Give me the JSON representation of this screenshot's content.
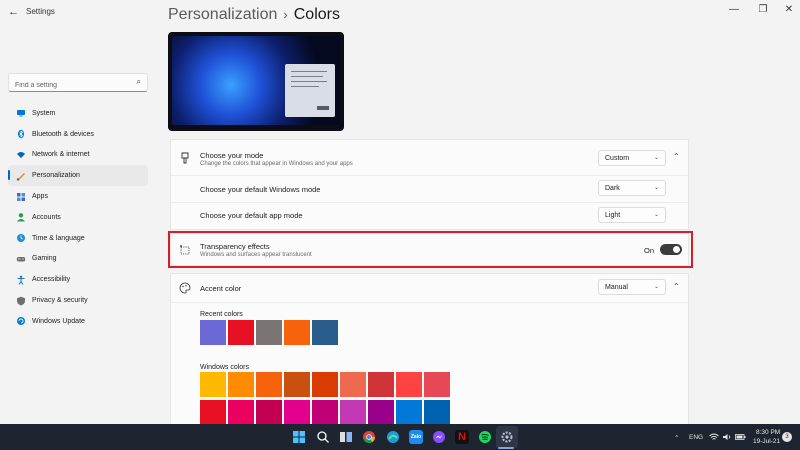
{
  "window": {
    "title": "Settings",
    "back_icon": "←",
    "minimize": "—",
    "maximize": "❐",
    "close": "✕"
  },
  "sidebar": {
    "search_placeholder": "Find a setting",
    "items": [
      {
        "label": "System",
        "icon": "monitor-icon",
        "color": "#0078d4"
      },
      {
        "label": "Bluetooth & devices",
        "icon": "bluetooth-icon",
        "color": "#0078d4"
      },
      {
        "label": "Network & internet",
        "icon": "wifi-icon",
        "color": "#0067c0"
      },
      {
        "label": "Personalization",
        "icon": "brush-icon",
        "color": "#d88a3c",
        "active": true
      },
      {
        "label": "Apps",
        "icon": "apps-icon",
        "color": "#3b6cc7"
      },
      {
        "label": "Accounts",
        "icon": "person-icon",
        "color": "#2a9a5b"
      },
      {
        "label": "Time & language",
        "icon": "globe-clock-icon",
        "color": "#1e8fd8"
      },
      {
        "label": "Gaming",
        "icon": "gamepad-icon",
        "color": "#6b6b6b"
      },
      {
        "label": "Accessibility",
        "icon": "accessibility-icon",
        "color": "#1a73c8"
      },
      {
        "label": "Privacy & security",
        "icon": "shield-icon",
        "color": "#6e6e6e"
      },
      {
        "label": "Windows Update",
        "icon": "update-icon",
        "color": "#0078d4"
      }
    ]
  },
  "header": {
    "parent": "Personalization",
    "separator": "›",
    "current": "Colors"
  },
  "mode": {
    "title": "Choose your mode",
    "desc": "Change the colors that appear in Windows and your apps",
    "value": "Custom",
    "windows_mode_label": "Choose your default Windows mode",
    "windows_mode_value": "Dark",
    "app_mode_label": "Choose your default app mode",
    "app_mode_value": "Light"
  },
  "transparency": {
    "title": "Transparency effects",
    "desc": "Windows and surfaces appear translucent",
    "state_label": "On"
  },
  "accent": {
    "title": "Accent color",
    "value": "Manual",
    "recent_label": "Recent colors",
    "recent_colors": [
      "#6b69d6",
      "#e81123",
      "#7a7574",
      "#f7630c",
      "#2b5d8c"
    ],
    "windows_label": "Windows colors",
    "windows_colors_row1": [
      "#ffb900",
      "#ff8c00",
      "#f7630c",
      "#ca5010",
      "#da3b01",
      "#ef6950",
      "#d13438",
      "#ff4343",
      "#e74856"
    ],
    "windows_colors_row2": [
      "#e81123",
      "#ea005e",
      "#c30052",
      "#e3008c",
      "#bf0077",
      "#c239b3",
      "#9a0089",
      "#0078d7",
      "#0063b1"
    ]
  },
  "taskbar": {
    "apps": [
      "windows-start-icon",
      "search-icon",
      "task-view-icon",
      "chrome-icon",
      "edge-icon",
      "zalo-icon",
      "messenger-icon",
      "netflix-icon",
      "spotify-icon",
      "settings-gear-icon"
    ],
    "language": "ENG",
    "time": "8:30 PM",
    "date": "19-Jul-21",
    "notification_count": "3"
  }
}
